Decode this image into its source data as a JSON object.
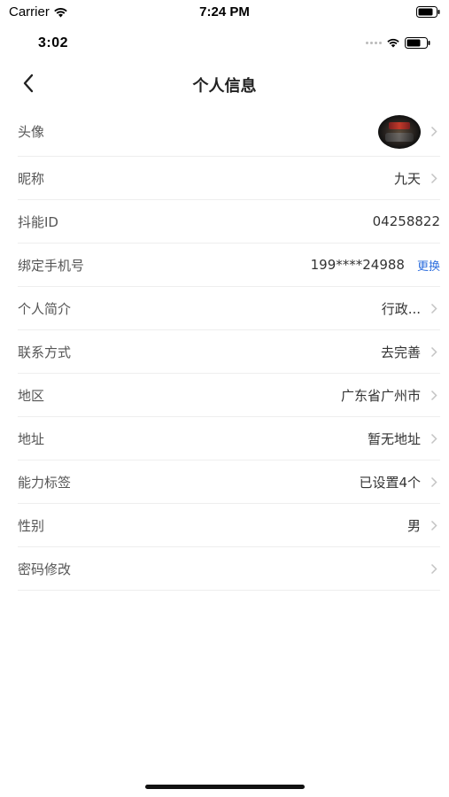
{
  "sim_status": {
    "carrier": "Carrier",
    "time": "7:24 PM"
  },
  "app_status": {
    "time": "3:02"
  },
  "navbar": {
    "title": "个人信息"
  },
  "rows": [
    {
      "label": "头像",
      "value": "",
      "type": "avatar"
    },
    {
      "label": "昵称",
      "value": "九天"
    },
    {
      "label": "抖能ID",
      "value": "04258822"
    },
    {
      "label": "绑定手机号",
      "value": "199****24988",
      "action": "更换"
    },
    {
      "label": "个人简介",
      "value": "行政..."
    },
    {
      "label": "联系方式",
      "value": "去完善"
    },
    {
      "label": "地区",
      "value": "广东省广州市"
    },
    {
      "label": "地址",
      "value": "暂无地址"
    },
    {
      "label": "能力标签",
      "value": "已设置4个"
    },
    {
      "label": "性别",
      "value": "男"
    },
    {
      "label": "密码修改",
      "value": ""
    }
  ],
  "colors": {
    "link": "#2f6fde",
    "divider": "#eeeeee",
    "label": "#555555"
  }
}
